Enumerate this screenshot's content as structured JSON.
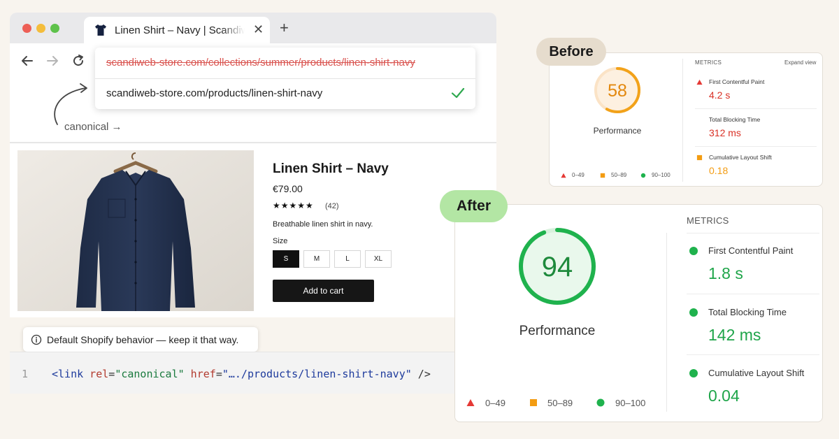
{
  "browser": {
    "tab_title": "Linen Shirt – Navy | Scandiweb Store",
    "tab_close": "✕",
    "new_tab": "+",
    "url_old": "scandiweb-store.com/collections/summer/products/linen-shirt-navy",
    "url_new": "scandiweb-store.com/products/linen-shirt-navy",
    "canonical_label": "canonical →"
  },
  "product": {
    "title": "Linen Shirt – Navy",
    "price": "€79.00",
    "stars": "★★★★★",
    "rating_count": "(42)",
    "description": "Breathable linen shirt in navy.",
    "size_label": "Size",
    "sizes": [
      "S",
      "M",
      "L",
      "XL"
    ],
    "selected_size": "S",
    "add_to_cart": "Add to cart"
  },
  "tooltip": {
    "text": "Default Shopify behavior — keep it that way."
  },
  "code": {
    "line_number": "1",
    "open": "<link",
    "rel_attr": " rel",
    "eq1": "=",
    "rel_val": "\"canonical\"",
    "href_attr": " href",
    "eq2": "=",
    "href_val": "\"…./products/linen-shirt-navy\"",
    "close": " />"
  },
  "before": {
    "badge": "Before",
    "score": 58,
    "score_label": "Performance",
    "metrics_title": "METRICS",
    "expand_label": "Expand view",
    "metrics": [
      {
        "name": "First Contentful Paint",
        "value": "4.2 s",
        "status": "fail"
      },
      {
        "name": "Total Blocking Time",
        "value": "312 ms",
        "status": "fail"
      },
      {
        "name": "Cumulative Layout Shift",
        "value": "0.18",
        "status": "average"
      }
    ],
    "legend": [
      "0–49",
      "50–89",
      "90–100"
    ]
  },
  "after": {
    "badge": "After",
    "score": 94,
    "score_label": "Performance",
    "metrics_title": "METRICS",
    "metrics": [
      {
        "name": "First Contentful Paint",
        "value": "1.8 s",
        "status": "pass"
      },
      {
        "name": "Total Blocking Time",
        "value": "142 ms",
        "status": "pass"
      },
      {
        "name": "Cumulative Layout Shift",
        "value": "0.04",
        "status": "pass"
      }
    ],
    "legend": [
      "0–49",
      "50–89",
      "90–100"
    ]
  },
  "colors": {
    "background": "#f8f4ee",
    "fail": "#e53935",
    "average": "#f39c12",
    "pass": "#1fb24d",
    "before_badge": "#e6dccd",
    "after_badge": "#b3e6a4"
  }
}
